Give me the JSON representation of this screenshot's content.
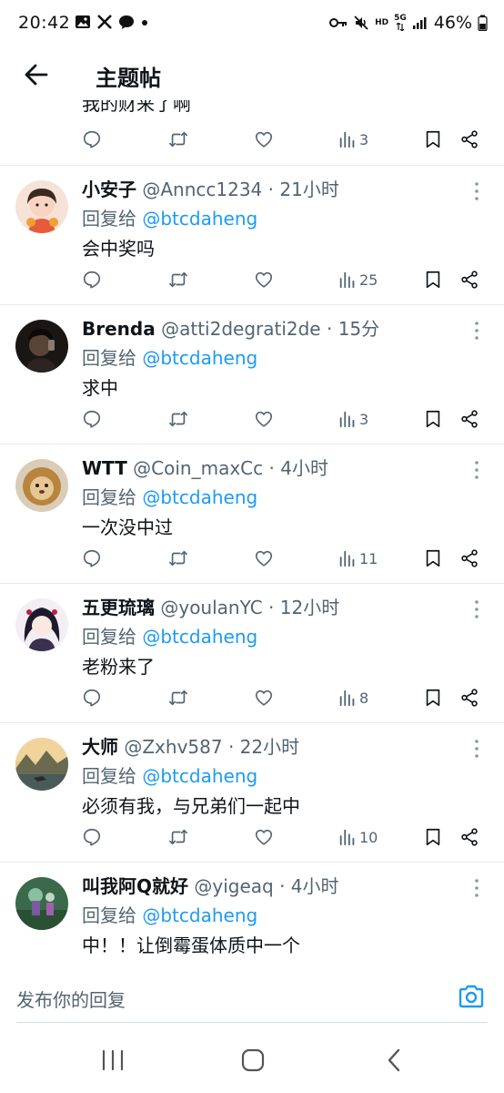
{
  "status_bar": {
    "time": "20:42",
    "battery": "46%",
    "network_hd": "HD",
    "network_5g": "5G"
  },
  "header": {
    "title": "主题帖"
  },
  "partial_reply": {
    "text": "我的财来了啊",
    "views": "3"
  },
  "replies": [
    {
      "name": "小安子",
      "handle": "@Anncc1234",
      "time": "21小时",
      "reply_prefix": "回复给",
      "reply_to": "@btcdaheng",
      "text": "会中奖吗",
      "views": "25",
      "avatar_color": "#f3c9b8"
    },
    {
      "name": "Brenda",
      "handle": "@atti2degrati2de",
      "time": "15分",
      "reply_prefix": "回复给",
      "reply_to": "@btcdaheng",
      "text": "求中",
      "views": "3",
      "avatar_color": "#2a2420"
    },
    {
      "name": "WTT",
      "handle": "@Coin_maxCc",
      "time": "4小时",
      "reply_prefix": "回复给",
      "reply_to": "@btcdaheng",
      "text": "一次没中过",
      "views": "11",
      "avatar_color": "#c69a5a"
    },
    {
      "name": "五更琉璃",
      "handle": "@youlanYC",
      "time": "12小时",
      "reply_prefix": "回复给",
      "reply_to": "@btcdaheng",
      "text": "老粉来了",
      "views": "8",
      "avatar_color": "#e8e0ec"
    },
    {
      "name": "大师",
      "handle": "@Zxhv587",
      "time": "22小时",
      "reply_prefix": "回复给",
      "reply_to": "@btcdaheng",
      "text": "必须有我，与兄弟们一起中",
      "views": "10",
      "avatar_color": "#9a8a6a"
    },
    {
      "name": "叫我阿Q就好",
      "handle": "@yigeaq",
      "time": "4小时",
      "reply_prefix": "回复给",
      "reply_to": "@btcdaheng",
      "text": "中！！让倒霉蛋体质中一个",
      "views": "",
      "avatar_color": "#4a7a5a"
    }
  ],
  "composer": {
    "placeholder": "发布你的回复"
  },
  "colors": {
    "accent": "#1d9bf0",
    "muted": "#536471",
    "divider": "#e6e9ec"
  },
  "icons": [
    "back-arrow-icon",
    "reply-icon",
    "retweet-icon",
    "like-icon",
    "views-icon",
    "bookmark-icon",
    "share-icon",
    "more-icon",
    "camera-icon"
  ]
}
